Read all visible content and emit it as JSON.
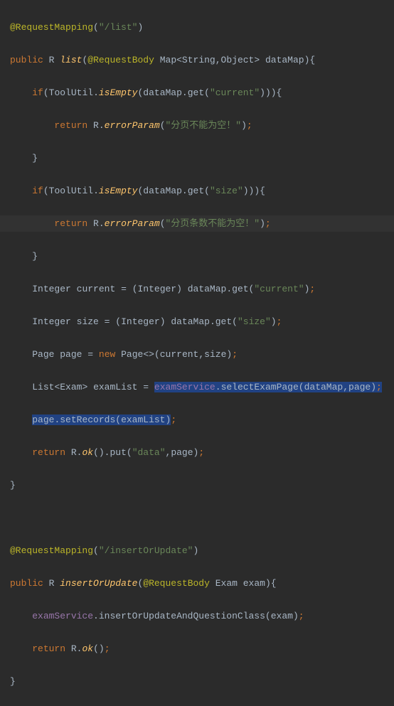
{
  "lines": {
    "l1": {
      "ann": "@RequestMapping",
      "s": "\"/list\""
    },
    "l2": {
      "kw1": "public",
      "ret": "R",
      "name": "list",
      "ann": "@RequestBody",
      "ptype": "Map",
      "gen": "<String,Object>",
      "pname": "dataMap"
    },
    "l3": {
      "kw": "if",
      "cls": "ToolUtil",
      "m": "isEmpty",
      "v": "dataMap",
      "g": "get",
      "s": "\"current\""
    },
    "l4": {
      "kw": "return",
      "cls": "R",
      "m": "errorParam",
      "s": "\"分页不能为空！\""
    },
    "l5": {
      "b": "}"
    },
    "l6": {
      "kw": "if",
      "cls": "ToolUtil",
      "m": "isEmpty",
      "v": "dataMap",
      "g": "get",
      "s": "\"size\""
    },
    "l7": {
      "kw": "return",
      "cls": "R",
      "m": "errorParam",
      "s": "\"分页条数不能为空！\""
    },
    "l8": {
      "b": "}"
    },
    "l9": {
      "t": "Integer",
      "v": "current",
      "c": "(Integer)",
      "d": "dataMap",
      "g": "get",
      "s": "\"current\""
    },
    "l10": {
      "t": "Integer",
      "v": "size",
      "c": "(Integer)",
      "d": "dataMap",
      "g": "get",
      "s": "\"size\""
    },
    "l11": {
      "t": "Page",
      "v": "page",
      "kw": "new",
      "ctor": "Page<>",
      "a1": "current",
      "a2": "size"
    },
    "l12": {
      "t": "List",
      "gen": "<Exam>",
      "v": "examList",
      "fld": "examService",
      "m": "selectExamPage",
      "a1": "dataMap",
      "a2": "page"
    },
    "l13": {
      "v": "page",
      "m": "setRecords",
      "a": "examList"
    },
    "l14": {
      "kw": "return",
      "cls": "R",
      "m1": "ok",
      "m2": "put",
      "s": "\"data\"",
      "a": "page"
    },
    "l15": {
      "b": "}"
    },
    "l17": {
      "ann": "@RequestMapping",
      "s": "\"/insertOrUpdate\""
    },
    "l18": {
      "kw1": "public",
      "ret": "R",
      "name": "insertOrUpdate",
      "ann": "@RequestBody",
      "ptype": "Exam",
      "pname": "exam"
    },
    "l19": {
      "fld": "examService",
      "m": "insertOrUpdateAndQuestionClass",
      "a": "exam"
    },
    "l20": {
      "kw": "return",
      "cls": "R",
      "m": "ok"
    },
    "l21": {
      "b": "}"
    }
  }
}
